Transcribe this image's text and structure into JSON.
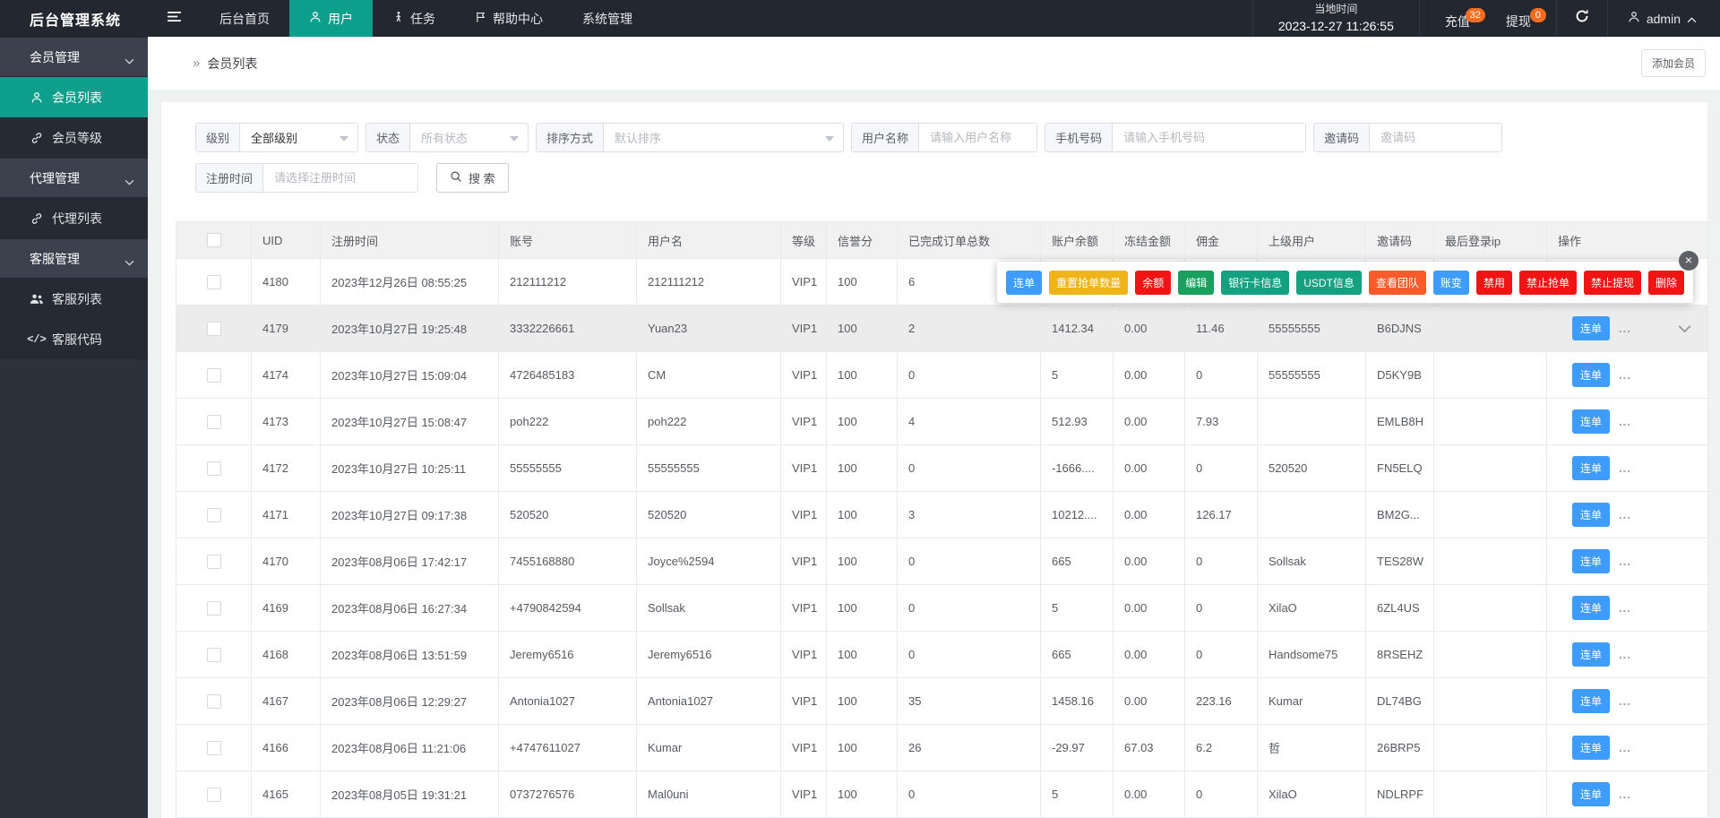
{
  "navbar": {
    "logo": "后台管理系统",
    "menu": [
      {
        "label": "后台首页",
        "icon": null,
        "active": false
      },
      {
        "label": "用户",
        "icon": "user",
        "active": true
      },
      {
        "label": "任务",
        "icon": "walker",
        "active": false
      },
      {
        "label": "帮助中心",
        "icon": "flag",
        "active": false
      },
      {
        "label": "系统管理",
        "icon": null,
        "active": false
      }
    ],
    "local_time_label": "当地时间",
    "local_time": "2023-12-27 11:26:55",
    "recharge": {
      "label": "充值",
      "badge": "32"
    },
    "withdraw": {
      "label": "提现",
      "badge": "0"
    },
    "username": "admin"
  },
  "sidebar": {
    "items": [
      {
        "type": "group",
        "label": "会员管理"
      },
      {
        "type": "item",
        "label": "会员列表",
        "icon": "user",
        "active": true
      },
      {
        "type": "item",
        "label": "会员等级",
        "icon": "link",
        "active": false
      },
      {
        "type": "group",
        "label": "代理管理"
      },
      {
        "type": "item",
        "label": "代理列表",
        "icon": "link",
        "active": false
      },
      {
        "type": "group",
        "label": "客服管理"
      },
      {
        "type": "item",
        "label": "客服列表",
        "icon": "users",
        "active": false
      },
      {
        "type": "item",
        "label": "客服代码",
        "icon": "code",
        "active": false
      }
    ]
  },
  "breadcrumb": {
    "separator": "»",
    "label": "会员列表"
  },
  "toolbar": {
    "add_member_label": "添加会员"
  },
  "filters": {
    "row1": [
      {
        "label": "级别",
        "type": "select",
        "value": "全部级别",
        "selected": true,
        "wclass": "w-level"
      },
      {
        "label": "状态",
        "type": "select",
        "value": "所有状态",
        "selected": false,
        "wclass": "w-status"
      },
      {
        "label": "排序方式",
        "type": "select",
        "value": "默认排序",
        "selected": false,
        "wclass": "w-sort"
      },
      {
        "label": "用户名称",
        "type": "input",
        "placeholder": "请输入用户名称",
        "wclass": "w-user"
      },
      {
        "label": "手机号码",
        "type": "input",
        "placeholder": "请输入手机号码",
        "wclass": "w-phone"
      },
      {
        "label": "邀请码",
        "type": "input",
        "placeholder": "邀请码",
        "wclass": "w-invite"
      }
    ],
    "row2": [
      {
        "label": "注册时间",
        "type": "input",
        "placeholder": "请选择注册时间",
        "wclass": "w-regtime"
      }
    ],
    "search_label": "搜 索"
  },
  "table": {
    "columns": [
      {
        "key": "checkbox",
        "label": ""
      },
      {
        "key": "uid",
        "label": "UID"
      },
      {
        "key": "time",
        "label": "注册时间"
      },
      {
        "key": "account",
        "label": "账号"
      },
      {
        "key": "username",
        "label": "用户名"
      },
      {
        "key": "level",
        "label": "等级"
      },
      {
        "key": "credit",
        "label": "信誉分"
      },
      {
        "key": "orders",
        "label": "已完成订单总数"
      },
      {
        "key": "balance",
        "label": "账户余额"
      },
      {
        "key": "frozen",
        "label": "冻结金额"
      },
      {
        "key": "commission",
        "label": "佣金"
      },
      {
        "key": "parent",
        "label": "上级用户"
      },
      {
        "key": "invite",
        "label": "邀请码"
      },
      {
        "key": "ip",
        "label": "最后登录ip"
      },
      {
        "key": "action",
        "label": "操作"
      }
    ],
    "action_label": "连单",
    "ellipsis": "...",
    "rows": [
      {
        "uid": "4180",
        "time": "2023年12月26日 08:55:25",
        "account": "212111212",
        "username": "212111212",
        "level": "VIP1",
        "credit": "100",
        "orders": "6",
        "balance": "",
        "frozen": "",
        "commission": "",
        "parent": "",
        "invite": "",
        "ip": "",
        "covered_by_popup": true
      },
      {
        "uid": "4179",
        "time": "2023年10月27日 19:25:48",
        "account": "3332226661",
        "username": "Yuan23",
        "level": "VIP1",
        "credit": "100",
        "orders": "2",
        "balance": "1412.34",
        "frozen": "0.00",
        "commission": "11.46",
        "parent": "55555555",
        "invite": "B6DJNS",
        "ip": ""
      },
      {
        "uid": "4174",
        "time": "2023年10月27日 15:09:04",
        "account": "4726485183",
        "username": "CM",
        "level": "VIP1",
        "credit": "100",
        "orders": "0",
        "balance": "5",
        "frozen": "0.00",
        "commission": "0",
        "parent": "55555555",
        "invite": "D5KY9B",
        "ip": ""
      },
      {
        "uid": "4173",
        "time": "2023年10月27日 15:08:47",
        "account": "poh222",
        "username": "poh222",
        "level": "VIP1",
        "credit": "100",
        "orders": "4",
        "balance": "512.93",
        "frozen": "0.00",
        "commission": "7.93",
        "parent": "",
        "invite": "EMLB8H",
        "ip": ""
      },
      {
        "uid": "4172",
        "time": "2023年10月27日 10:25:11",
        "account": "55555555",
        "username": "55555555",
        "level": "VIP1",
        "credit": "100",
        "orders": "0",
        "balance": "-1666....",
        "frozen": "0.00",
        "commission": "0",
        "parent": "520520",
        "invite": "FN5ELQ",
        "ip": ""
      },
      {
        "uid": "4171",
        "time": "2023年10月27日 09:17:38",
        "account": "520520",
        "username": "520520",
        "level": "VIP1",
        "credit": "100",
        "orders": "3",
        "balance": "10212....",
        "frozen": "0.00",
        "commission": "126.17",
        "parent": "",
        "invite": "BM2G...",
        "ip": ""
      },
      {
        "uid": "4170",
        "time": "2023年08月06日 17:42:17",
        "account": "7455168880",
        "username": "Joyce%2594",
        "level": "VIP1",
        "credit": "100",
        "orders": "0",
        "balance": "665",
        "frozen": "0.00",
        "commission": "0",
        "parent": "Sollsak",
        "invite": "TES28W",
        "ip": ""
      },
      {
        "uid": "4169",
        "time": "2023年08月06日 16:27:34",
        "account": "+4790842594",
        "username": "Sollsak",
        "level": "VIP1",
        "credit": "100",
        "orders": "0",
        "balance": "5",
        "frozen": "0.00",
        "commission": "0",
        "parent": "XilaO",
        "invite": "6ZL4US",
        "ip": ""
      },
      {
        "uid": "4168",
        "time": "2023年08月06日 13:51:59",
        "account": "Jeremy6516",
        "username": "Jeremy6516",
        "level": "VIP1",
        "credit": "100",
        "orders": "0",
        "balance": "665",
        "frozen": "0.00",
        "commission": "0",
        "parent": "Handsome75",
        "invite": "8RSEHZ",
        "ip": ""
      },
      {
        "uid": "4167",
        "time": "2023年08月06日 12:29:27",
        "account": "Antonia1027",
        "username": "Antonia1027",
        "level": "VIP1",
        "credit": "100",
        "orders": "35",
        "balance": "1458.16",
        "frozen": "0.00",
        "commission": "223.16",
        "parent": "Kumar",
        "invite": "DL74BG",
        "ip": ""
      },
      {
        "uid": "4166",
        "time": "2023年08月06日 11:21:06",
        "account": "+4747611027",
        "username": "Kumar",
        "level": "VIP1",
        "credit": "100",
        "orders": "26",
        "balance": "-29.97",
        "frozen": "67.03",
        "commission": "6.2",
        "parent": "哲",
        "invite": "26BRP5",
        "ip": ""
      },
      {
        "uid": "4165",
        "time": "2023年08月05日 19:31:21",
        "account": "0737276576",
        "username": "Mal0uni",
        "level": "VIP1",
        "credit": "100",
        "orders": "0",
        "balance": "5",
        "frozen": "0.00",
        "commission": "0",
        "parent": "XilaO",
        "invite": "NDLRPF",
        "ip": ""
      }
    ]
  },
  "popup": {
    "anchor_uid": "4179",
    "close_glyph": "×",
    "actions": [
      {
        "label": "连单",
        "color": "#3e9cff"
      },
      {
        "label": "重置抢单数量",
        "color": "#efb41a"
      },
      {
        "label": "余额",
        "color": "#f01414"
      },
      {
        "label": "编辑",
        "color": "#18a05f"
      },
      {
        "label": "银行卡信息",
        "color": "#13a182"
      },
      {
        "label": "USDT信息",
        "color": "#13a182"
      },
      {
        "label": "查看团队",
        "color": "#fb5b2a"
      },
      {
        "label": "账变",
        "color": "#3e9cff"
      },
      {
        "label": "禁用",
        "color": "#f01414"
      },
      {
        "label": "禁止抢单",
        "color": "#f01414"
      },
      {
        "label": "禁止提现",
        "color": "#f01414"
      },
      {
        "label": "删除",
        "color": "#f01414"
      }
    ]
  },
  "colors": {
    "accent_teal": "#0e9f8c",
    "navbar_bg": "#23272f",
    "sidebar_bg": "#2c323c",
    "badge_orange": "#fb6d1e",
    "primary_blue": "#3e9cff",
    "danger_red": "#f01414",
    "warning_yellow": "#efb41a",
    "success_green": "#13a182",
    "team_orange": "#fb5b2a"
  }
}
